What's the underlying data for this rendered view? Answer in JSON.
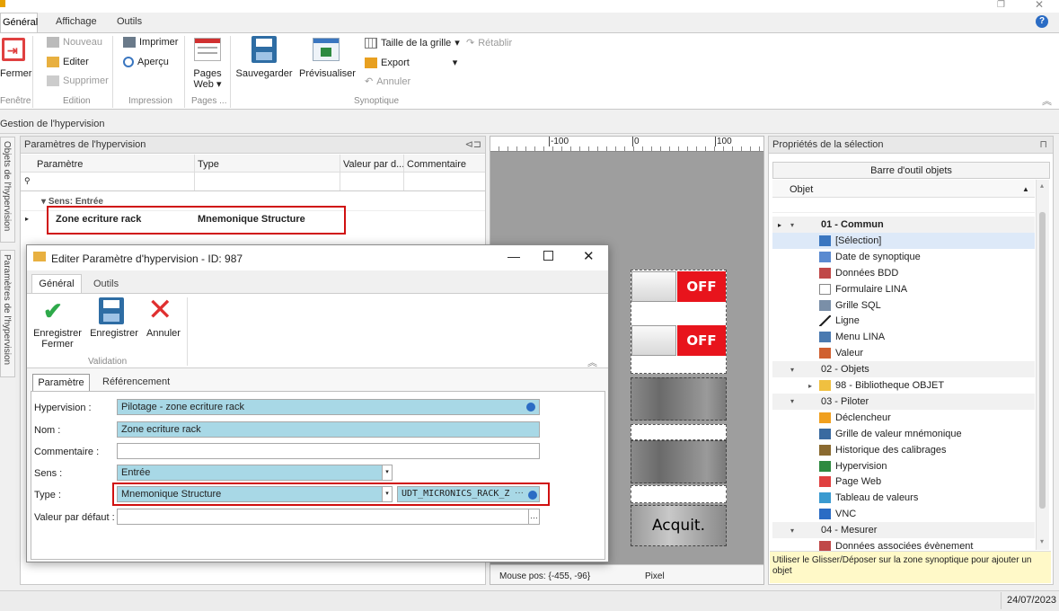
{
  "tabs": [
    {
      "label": "Général"
    },
    {
      "label": "Affichage"
    },
    {
      "label": "Outils"
    }
  ],
  "ribbon": {
    "fenetre": {
      "close_label": "Fermer",
      "group_label": "Fenêtre"
    },
    "edition": {
      "new_label": "Nouveau",
      "edit_label": "Editer",
      "delete_label": "Supprimer",
      "group_label": "Edition"
    },
    "impression": {
      "print_label": "Imprimer",
      "preview_label": "Aperçu",
      "group_label": "Impression"
    },
    "pages": {
      "web_label": "Pages Web",
      "group_label": "Pages ..."
    },
    "synoptique": {
      "save_label": "Sauvegarder",
      "preview_label": "Prévisualiser",
      "grid_size_label": "Taille de la grille",
      "export_label": "Export",
      "cancel_label": "Annuler",
      "redo_label": "Rétablir",
      "group_label": "Synoptique"
    }
  },
  "breadcrumb": "Gestion de l'hypervision",
  "side_tabs": [
    "Objets de l'hypervision",
    "Paramètres de l'hypervision"
  ],
  "params_panel": {
    "title": "Paramètres de l'hypervision",
    "columns": [
      "Paramètre",
      "Type",
      "Valeur par d...",
      "Commentaire"
    ],
    "group_label": "Sens: Entrée",
    "row": {
      "param": "Zone ecriture rack",
      "type": "Mnemonique Structure"
    }
  },
  "dialog": {
    "title": "Editer Paramètre d'hypervision - ID: 987",
    "tabs": [
      "Général",
      "Outils"
    ],
    "actions": {
      "save_close": "Enregistrer Fermer",
      "save": "Enregistrer",
      "cancel": "Annuler",
      "group_label": "Validation"
    },
    "subtabs": [
      "Paramètre",
      "Référencement"
    ],
    "fields": {
      "hypervision": {
        "label": "Hypervision :",
        "value": "Pilotage - zone ecriture rack"
      },
      "nom": {
        "label": "Nom :",
        "value": "Zone ecriture rack"
      },
      "commentaire": {
        "label": "Commentaire :",
        "value": ""
      },
      "sens": {
        "label": "Sens :",
        "value": "Entrée"
      },
      "type": {
        "label": "Type :",
        "value": "Mnemonique Structure",
        "ref_value": "UDT_MICRONICS_RACK_Z"
      },
      "valeur": {
        "label": "Valeur par défaut :",
        "value": ""
      }
    }
  },
  "canvas": {
    "ruler_ticks": [
      "-100",
      "0",
      "100"
    ],
    "off_label": "OFF",
    "acquit_label": "Acquit.",
    "status_mouse": "Mouse pos: {-455, -96}",
    "status_unit": "Pixel"
  },
  "props_panel": {
    "title": "Propriétés de la sélection",
    "toolbar_title": "Barre d'outil objets",
    "column": "Objet",
    "tree": [
      {
        "label": "01 - Commun",
        "kind": "group"
      },
      {
        "label": "[Sélection]",
        "kind": "item",
        "icon": "cursor-icon"
      },
      {
        "label": "Date de synoptique",
        "kind": "item",
        "icon": "calendar-icon"
      },
      {
        "label": "Données BDD",
        "kind": "item",
        "icon": "database-icon"
      },
      {
        "label": "Formulaire LINA",
        "kind": "item",
        "icon": "form-icon"
      },
      {
        "label": "Grille SQL",
        "kind": "item",
        "icon": "grid-icon"
      },
      {
        "label": "Ligne",
        "kind": "item",
        "icon": "line-icon"
      },
      {
        "label": "Menu LINA",
        "kind": "item",
        "icon": "menu-icon"
      },
      {
        "label": "Valeur",
        "kind": "item",
        "icon": "value-icon"
      },
      {
        "label": "02 - Objets",
        "kind": "group"
      },
      {
        "label": "98 - Bibliotheque OBJET",
        "kind": "folder",
        "icon": "folder-icon"
      },
      {
        "label": "03 - Piloter",
        "kind": "group"
      },
      {
        "label": "Déclencheur",
        "kind": "item",
        "icon": "lightning-icon"
      },
      {
        "label": "Grille de valeur mnémonique",
        "kind": "item",
        "icon": "grid-value-icon"
      },
      {
        "label": "Historique des calibrages",
        "kind": "item",
        "icon": "history-icon"
      },
      {
        "label": "Hypervision",
        "kind": "item",
        "icon": "hypervision-icon"
      },
      {
        "label": "Page Web",
        "kind": "item",
        "icon": "chrome-icon"
      },
      {
        "label": "Tableau de valeurs",
        "kind": "item",
        "icon": "table-icon"
      },
      {
        "label": "VNC",
        "kind": "item",
        "icon": "vnc-icon"
      },
      {
        "label": "04 - Mesurer",
        "kind": "group"
      },
      {
        "label": "Données associées évènement",
        "kind": "item",
        "icon": "event-data-icon"
      }
    ],
    "hint": "Utiliser le Glisser/Déposer sur la zone synoptique pour ajouter un objet"
  },
  "status_date": "24/07/2023",
  "colors": {
    "accent_red": "#d01010",
    "field_blue": "#a8d8e6",
    "off_red": "#e8141c"
  }
}
